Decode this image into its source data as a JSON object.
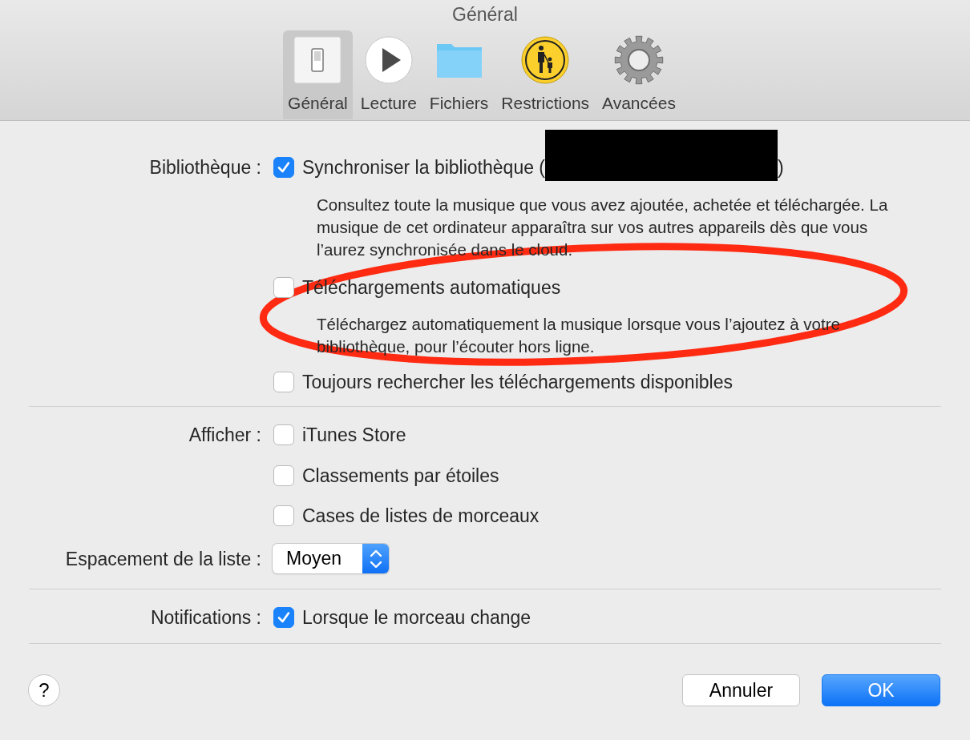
{
  "window": {
    "title": "Général"
  },
  "toolbar": [
    {
      "label": "Général",
      "selected": true
    },
    {
      "label": "Lecture",
      "selected": false
    },
    {
      "label": "Fichiers",
      "selected": false
    },
    {
      "label": "Restrictions",
      "selected": false
    },
    {
      "label": "Avancées",
      "selected": false
    }
  ],
  "sections": [
    {
      "rows": [
        {
          "kind": "checkbox",
          "label": "Bibliothèque :",
          "text": "Synchroniser la bibliothèque (",
          "redacted": true,
          "text_after": ")",
          "checked": true,
          "description": "Consultez toute la musique que vous avez ajoutée, achetée et téléchargée. La musique de cet ordinateur apparaîtra sur vos autres appareils dès que vous l’aurez synchronisée dans le cloud."
        },
        {
          "kind": "checkbox",
          "text": "Téléchargements automatiques",
          "checked": false,
          "description": "Téléchargez automatiquement la musique lorsque vous l’ajoutez à votre bibliothèque, pour l’écouter hors ligne."
        },
        {
          "kind": "checkbox",
          "text": "Toujours rechercher les téléchargements disponibles",
          "checked": false
        }
      ]
    },
    {
      "rows": [
        {
          "kind": "checkbox",
          "label": "Afficher :",
          "text": "iTunes Store",
          "checked": false
        },
        {
          "kind": "checkbox",
          "text": "Classements par étoiles",
          "checked": false
        },
        {
          "kind": "checkbox",
          "text": "Cases de listes de morceaux",
          "checked": false
        },
        {
          "kind": "select",
          "label": "Espacement de la liste :",
          "value": "Moyen"
        }
      ]
    },
    {
      "rows": [
        {
          "kind": "checkbox",
          "label": "Notifications :",
          "text": "Lorsque le morceau change",
          "checked": true
        }
      ]
    }
  ],
  "buttons": [
    {
      "kind": "help",
      "text": "?"
    },
    {
      "kind": "cancel",
      "text": "Annuler"
    },
    {
      "kind": "default",
      "text": "OK"
    }
  ],
  "annotation": {
    "kind": "ellipse",
    "color": "#ff2a12"
  }
}
